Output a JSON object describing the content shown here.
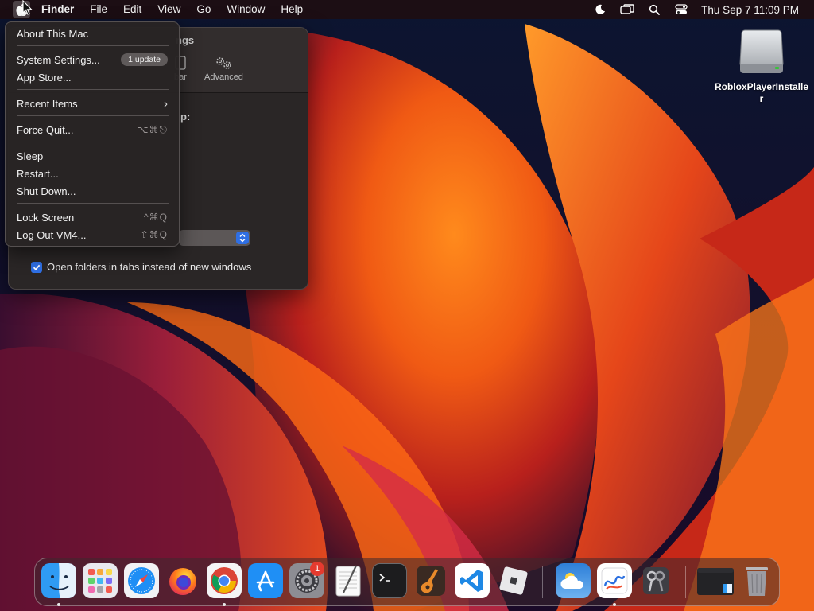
{
  "menubar": {
    "app_name": "Finder",
    "menus": [
      "File",
      "Edit",
      "View",
      "Go",
      "Window",
      "Help"
    ],
    "clock": "Thu Sep 7  11:09 PM"
  },
  "apple_menu": {
    "items": [
      {
        "label": "About This Mac"
      },
      {
        "label": "System Settings...",
        "badge": "1 update"
      },
      {
        "label": "App Store..."
      },
      {
        "label": "Recent Items"
      },
      {
        "label": "Force Quit...",
        "shortcut": "⌥⌘⎋"
      },
      {
        "label": "Sleep"
      },
      {
        "label": "Restart..."
      },
      {
        "label": "Shut Down..."
      },
      {
        "label": "Lock Screen",
        "shortcut": "^⌘Q"
      },
      {
        "label": "Log Out VM4...",
        "shortcut": "⇧⌘Q"
      }
    ]
  },
  "settings_window": {
    "title_partial": "ngs",
    "tabs": [
      {
        "label": "bar"
      },
      {
        "label": "Advanced"
      }
    ],
    "partial_label": "p:",
    "checkbox_label": "Open folders in tabs instead of new windows",
    "checkbox_checked": true
  },
  "desktop": {
    "icon_label": "RobloxPlayerInstaller"
  },
  "dock": {
    "apps": [
      "Finder",
      "Launchpad",
      "Safari",
      "Firefox",
      "Google Chrome",
      "App Store",
      "System Settings",
      "TextEdit",
      "Terminal",
      "GarageBand",
      "Visual Studio Code",
      "Roblox",
      "Weather",
      "Freeform",
      "Keychain Access",
      "Finder Window",
      "Trash"
    ],
    "system_settings_badge": "1"
  },
  "colors": {
    "accent": "#2f6fe4",
    "badge_red": "#e53a2f"
  }
}
